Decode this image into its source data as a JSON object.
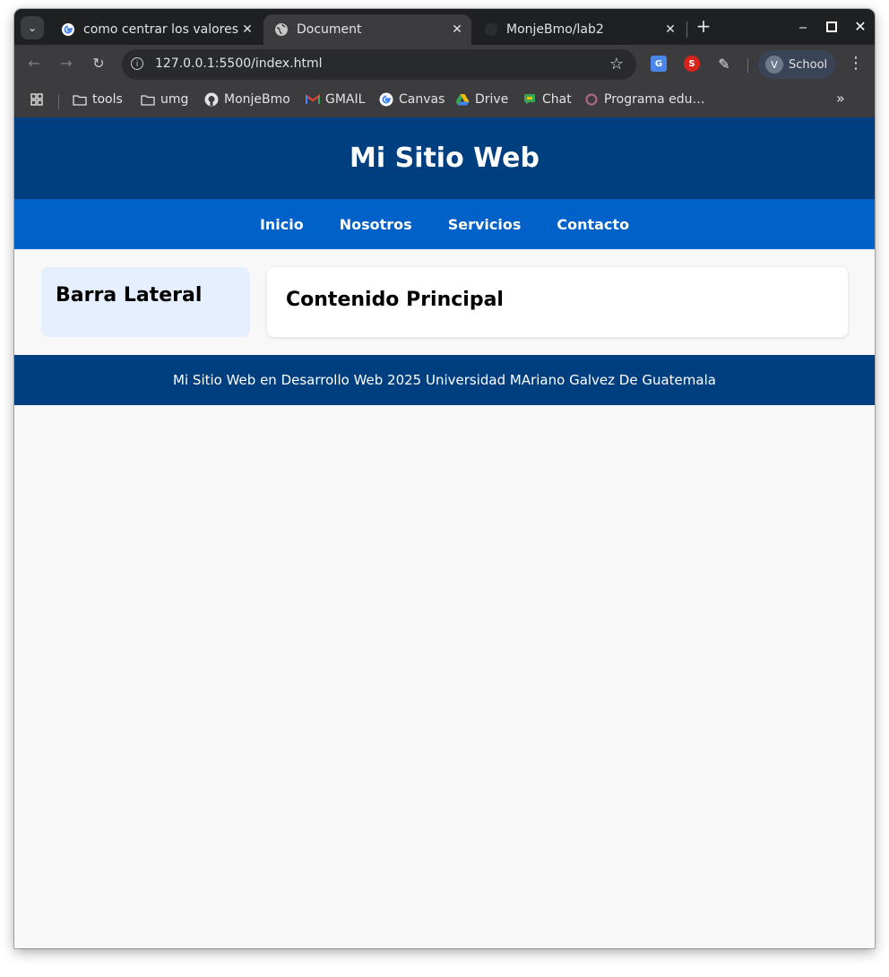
{
  "browser": {
    "tabs": [
      {
        "title": "como centrar los valores",
        "favicon": "google-icon",
        "active": false
      },
      {
        "title": "Document",
        "favicon": "globe-icon",
        "active": true
      },
      {
        "title": "MonjeBmo/lab2",
        "favicon": "github-icon",
        "active": false
      }
    ],
    "url": "127.0.0.1:5500/index.html",
    "profile_initial": "V",
    "profile_label": "School",
    "bookmarks": [
      {
        "label": "tools",
        "icon": "folder-icon"
      },
      {
        "label": "umg",
        "icon": "folder-icon"
      },
      {
        "label": "MonjeBmo",
        "icon": "github-icon"
      },
      {
        "label": "GMAIL",
        "icon": "gmail-icon"
      },
      {
        "label": "Canvas",
        "icon": "google-icon"
      },
      {
        "label": "Drive",
        "icon": "drive-icon"
      },
      {
        "label": "Chat",
        "icon": "chat-icon"
      },
      {
        "label": "Programa edu…",
        "icon": "circle-icon"
      }
    ]
  },
  "site": {
    "title": "Mi Sitio Web",
    "nav": [
      "Inicio",
      "Nosotros",
      "Servicios",
      "Contacto"
    ],
    "sidebar_title": "Barra Lateral",
    "main_title": "Contenido Principal",
    "footer": "Mi Sitio Web en Desarrollo Web 2025 Universidad MAriano Galvez De Guatemala"
  },
  "colors": {
    "header": "#003f7f",
    "nav": "#0061c8",
    "sidebar": "#e6effd",
    "footer": "#003f7f"
  }
}
